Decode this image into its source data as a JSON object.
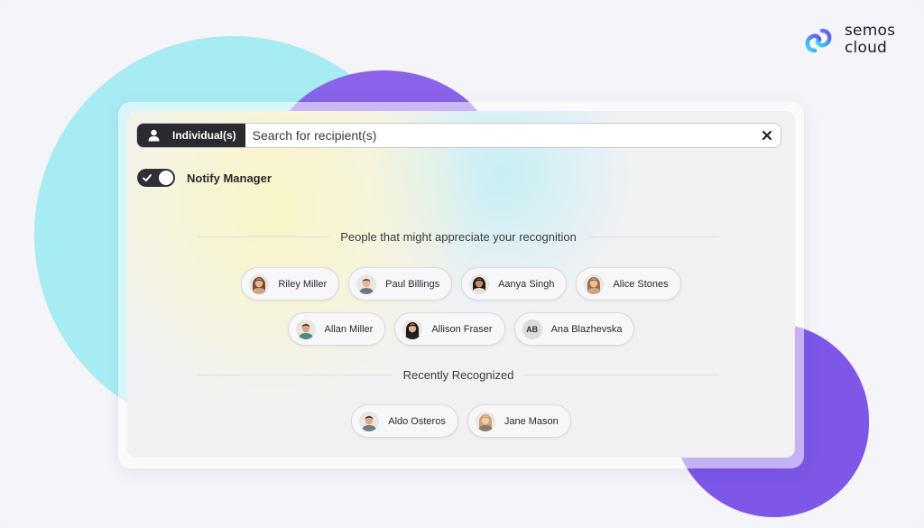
{
  "brand": {
    "line1": "semos",
    "line2": "cloud",
    "logo_icon": "semos-cloud-logo-icon",
    "colors": {
      "gradient_start": "#2ee0f0",
      "gradient_end": "#6b4ff0"
    }
  },
  "search": {
    "scope_icon": "person-icon",
    "scope_label": "Individual(s)",
    "placeholder": "Search for recipient(s)",
    "clear_icon": "close-icon"
  },
  "notify": {
    "label": "Notify Manager",
    "enabled": true,
    "check_icon": "check-icon"
  },
  "suggestions": {
    "title": "People that might appreciate your recognition",
    "rows": [
      [
        {
          "name": "Riley Miller",
          "avatar": "woman",
          "hair": "#7a4a30",
          "skin": "#e7b596",
          "shirt": "#c9a98e"
        },
        {
          "name": "Paul Billings",
          "avatar": "man",
          "hair": "#4a4a4a",
          "skin": "#e2b79a",
          "shirt": "#6d7785"
        },
        {
          "name": "Aanya Singh",
          "avatar": "woman",
          "hair": "#1e1a18",
          "skin": "#c58b69",
          "shirt": "#e7e3dc"
        },
        {
          "name": "Alice Stones",
          "avatar": "woman",
          "hair": "#a36b45",
          "skin": "#eac1a6",
          "shirt": "#caa489"
        }
      ],
      [
        {
          "name": "Allan Miller",
          "avatar": "man",
          "hair": "#3b2b22",
          "skin": "#d9a584",
          "shirt": "#4e8c83"
        },
        {
          "name": "Allison Fraser",
          "avatar": "woman",
          "hair": "#1c1816",
          "skin": "#e0b092",
          "shirt": "#232323"
        },
        {
          "name": "Ana Blazhevska",
          "avatar": "initials",
          "initials": "AB"
        }
      ]
    ]
  },
  "recent": {
    "title": "Recently Recognized",
    "rows": [
      [
        {
          "name": "Aldo Osteros",
          "avatar": "man",
          "hair": "#3a2c24",
          "skin": "#dba88a",
          "shirt": "#6f7c8a"
        },
        {
          "name": "Jane Mason",
          "avatar": "woman",
          "hair": "#caa56e",
          "skin": "#efc8ad",
          "shirt": "#8c7a6b"
        }
      ]
    ]
  }
}
